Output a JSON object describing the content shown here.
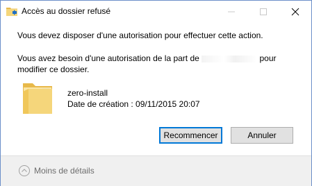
{
  "window": {
    "title": "Accès au dossier refusé",
    "icon": "folder-access-icon",
    "controls": {
      "minimize": "minimize-icon",
      "maximize": "maximize-icon",
      "close": "close-icon"
    }
  },
  "message": {
    "line1": "Vous devez disposer d'une autorisation pour effectuer cette action.",
    "line2_before": "Vous avez besoin d'une autorisation de la part de ",
    "line2_after": " pour modifier ce dossier."
  },
  "folder": {
    "icon": "folder-icon",
    "name": "zero-install",
    "created": "Date de création : 09/11/2015 20:07"
  },
  "buttons": {
    "retry": "Recommencer",
    "cancel": "Annuler"
  },
  "footer": {
    "details_label": "Moins de détails",
    "details_icon": "chevron-up-icon"
  },
  "colors": {
    "accent": "#0078d7",
    "window_border": "#6b8fc9",
    "footer_bg": "#f0f0f0",
    "button_bg": "#e1e1e1",
    "folder_yellow": "#f5d67b"
  }
}
